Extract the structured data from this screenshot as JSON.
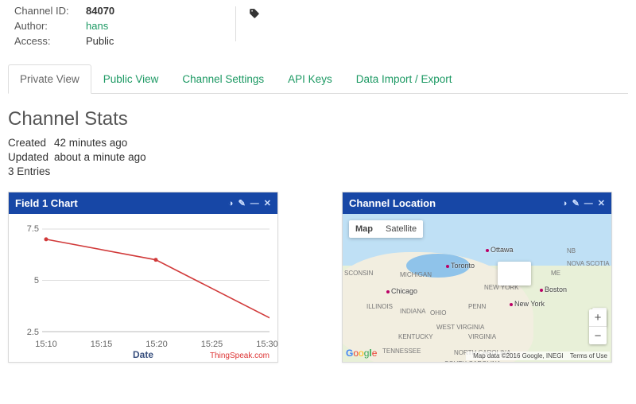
{
  "info": {
    "channel_id_label": "Channel ID:",
    "channel_id": "84070",
    "author_label": "Author:",
    "author": "hans",
    "access_label": "Access:",
    "access": "Public"
  },
  "tabs": {
    "private": "Private View",
    "public": "Public View",
    "settings": "Channel Settings",
    "apikeys": "API Keys",
    "import": "Data Import / Export"
  },
  "stats": {
    "heading": "Channel Stats",
    "created_label": "Created",
    "created": "42 minutes ago",
    "updated_label": "Updated",
    "updated": "about a minute ago",
    "entries": "3 Entries"
  },
  "chart_panel": {
    "title": "Field 1 Chart",
    "xlabel": "Date",
    "attribution": "ThingSpeak.com"
  },
  "chart_data": {
    "type": "line",
    "x": [
      "15:10",
      "15:15",
      "15:20",
      "15:25",
      "15:30"
    ],
    "series": [
      {
        "name": "Field 1",
        "points": [
          {
            "x": "15:10",
            "y": 7.0
          },
          {
            "x": "15:20",
            "y": 6.0
          },
          {
            "x": "15:31",
            "y": 3.0
          }
        ]
      }
    ],
    "ylim": [
      2.5,
      7.5
    ],
    "yticks": [
      2.5,
      5,
      7.5
    ],
    "xticks": [
      "15:10",
      "15:15",
      "15:20",
      "15:25",
      "15:30"
    ],
    "xlabel": "Date",
    "grid": true
  },
  "map_panel": {
    "title": "Channel Location",
    "maptype_map": "Map",
    "maptype_sat": "Satellite",
    "cities": [
      "Ottawa",
      "Toronto",
      "Chicago",
      "New York",
      "Boston"
    ],
    "states": [
      "SCONSIN",
      "MICHIGAN",
      "ILLINOIS",
      "INDIANA",
      "OHIO",
      "PENN",
      "NEW YORK",
      "WEST VIRGINIA",
      "VIRGINIA",
      "KENTUCKY",
      "TENNESSEE",
      "NORTH CAROLINA",
      "SOUTH CAROLINA",
      "NB",
      "NOVA SCOTIA",
      "ME"
    ],
    "footer_data": "Map data ©2016 Google, INEGI",
    "footer_terms": "Terms of Use",
    "logo": "Google"
  }
}
